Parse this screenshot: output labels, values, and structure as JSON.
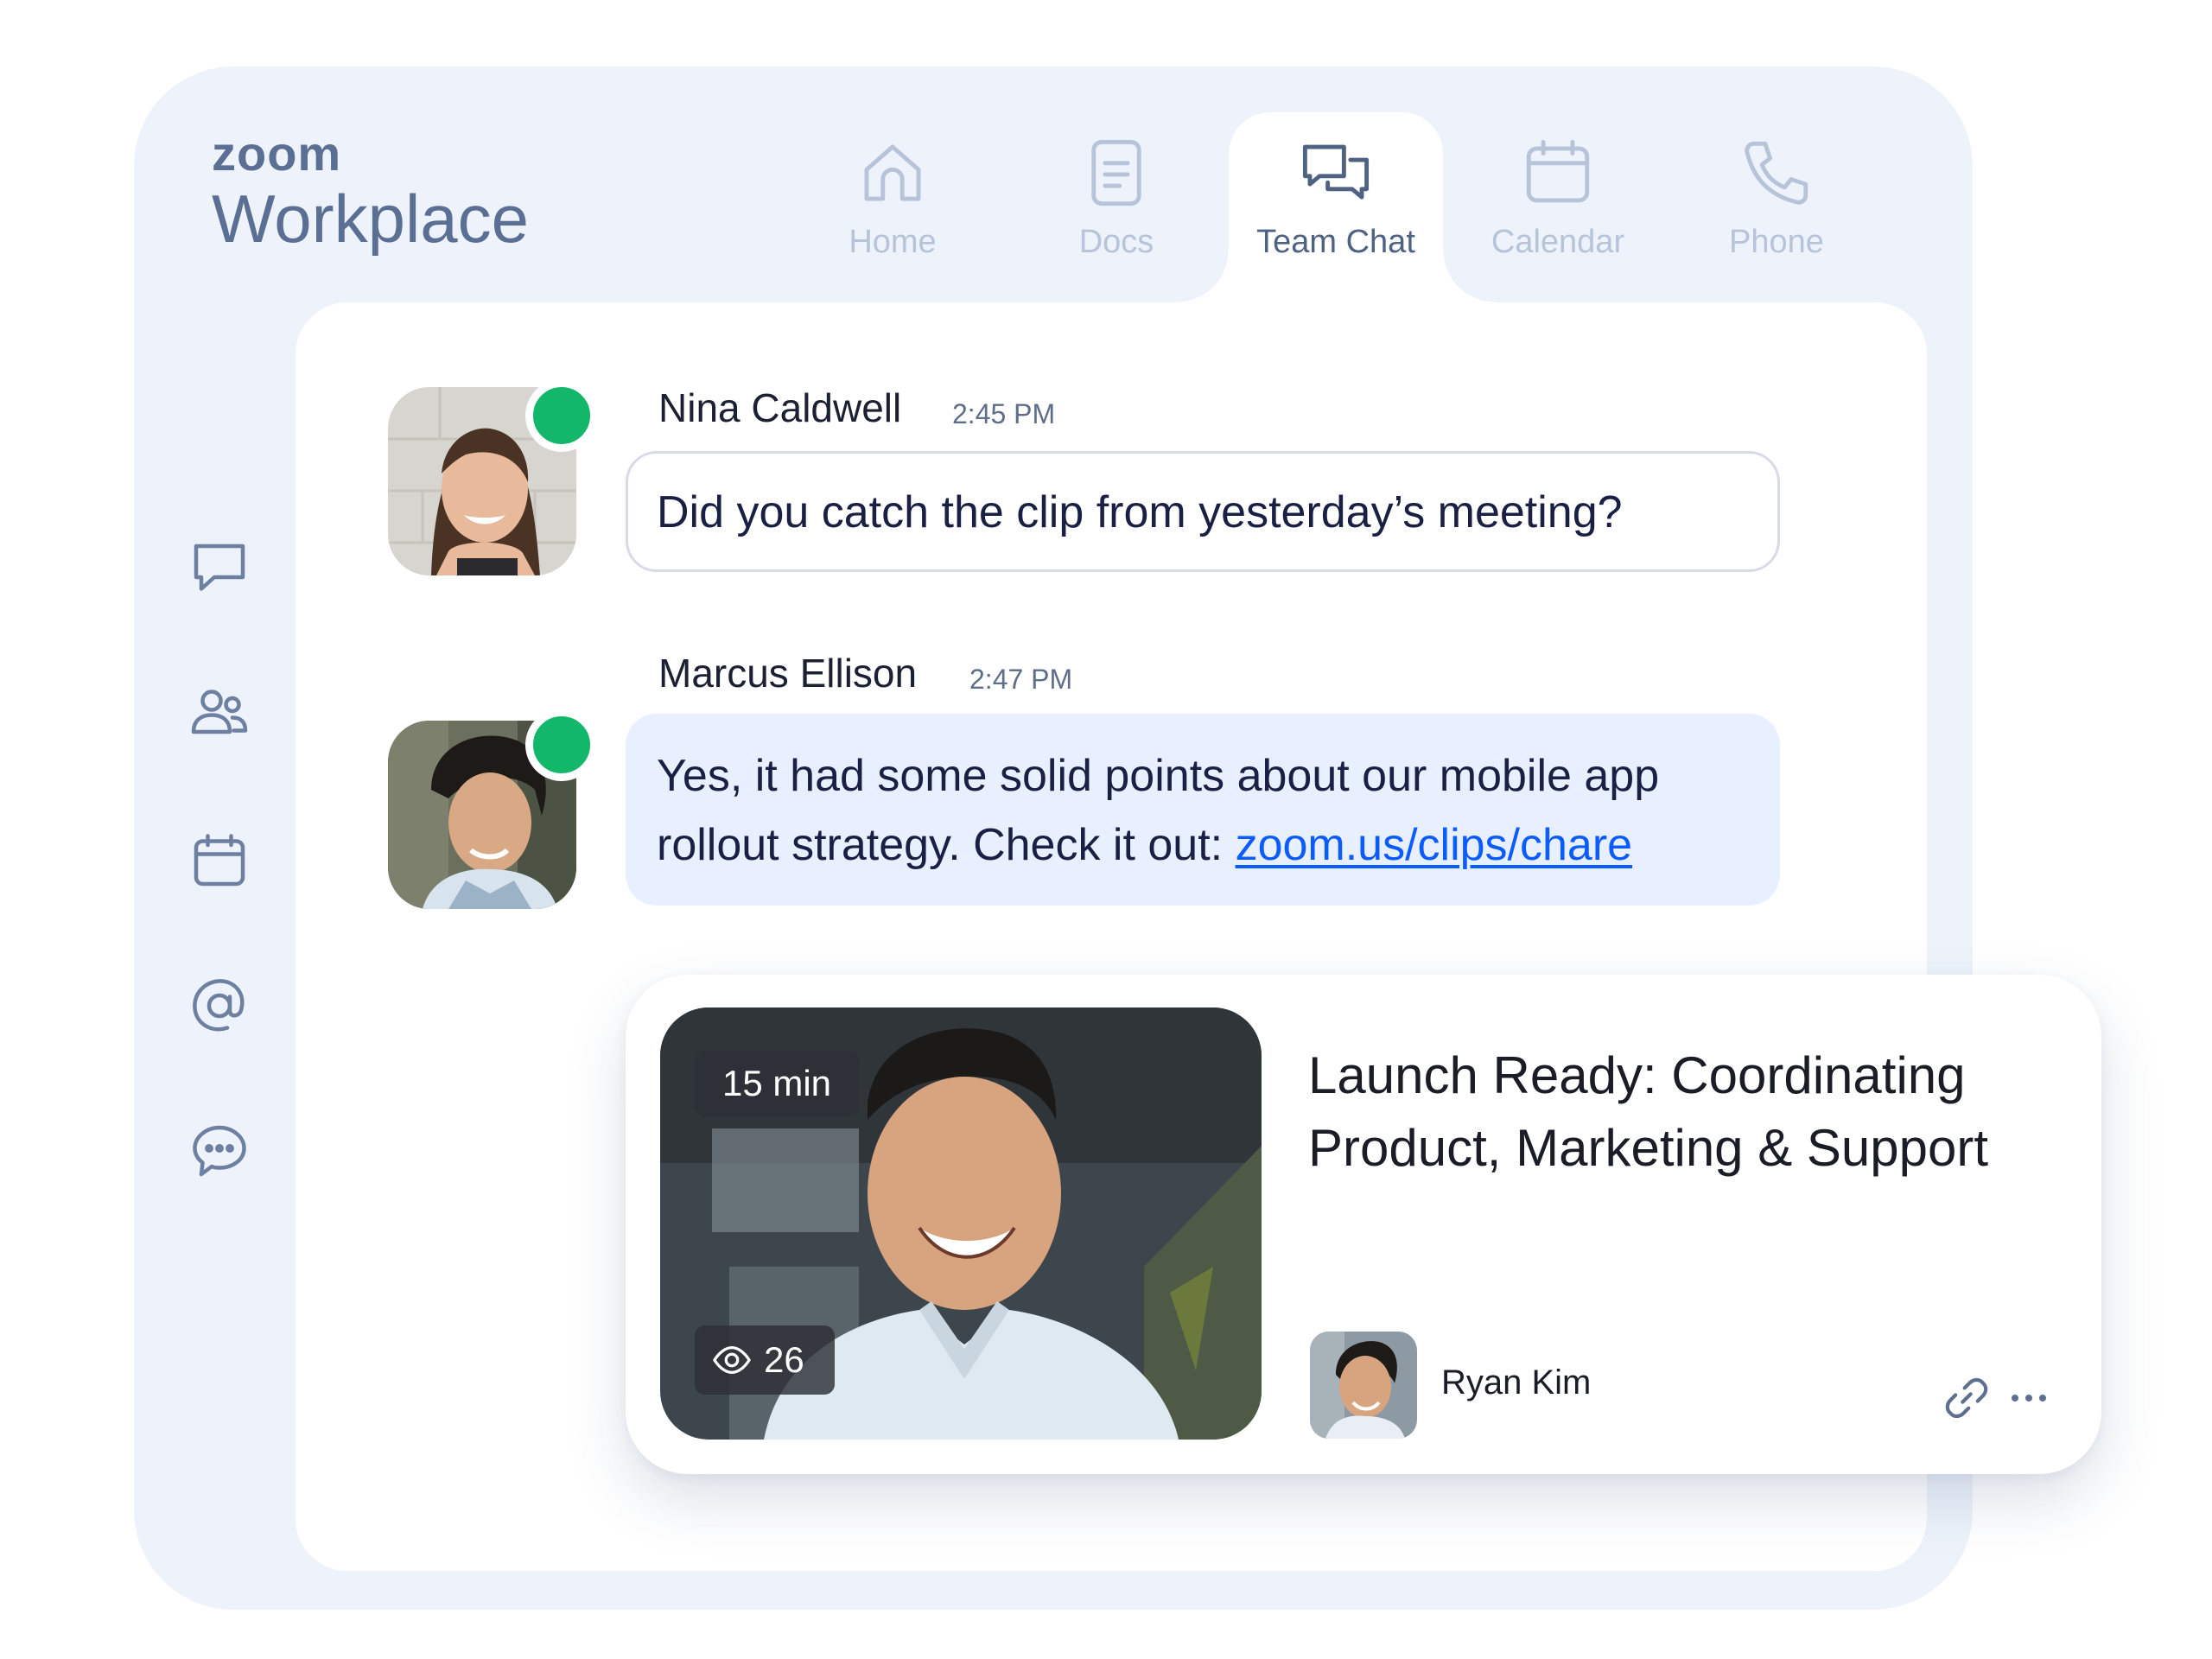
{
  "brand": {
    "logo_text": "zoom",
    "product": "Workplace"
  },
  "nav": {
    "tabs": [
      {
        "label": "Home",
        "icon": "home-icon",
        "active": false
      },
      {
        "label": "Docs",
        "icon": "document-icon",
        "active": false
      },
      {
        "label": "Team Chat",
        "icon": "chat-bubbles-icon",
        "active": true
      },
      {
        "label": "Calendar",
        "icon": "calendar-icon",
        "active": false
      },
      {
        "label": "Phone",
        "icon": "phone-icon",
        "active": false
      }
    ]
  },
  "sidebar": {
    "icons": [
      "chat-icon",
      "contacts-icon",
      "calendar-icon",
      "mentions-icon",
      "bot-chat-icon"
    ]
  },
  "messages": [
    {
      "sender": "Nina Caldwell",
      "time": "2:45 PM",
      "text": "Did you catch the clip from yesterday’s meeting?",
      "online": true
    },
    {
      "sender": "Marcus Ellison",
      "time": "2:47 PM",
      "text_line1": "Yes, it had some solid points about our mobile app",
      "text_line2": "rollout strategy. Check it out: ",
      "link": "zoom.us/clips/chare",
      "online": true
    }
  ],
  "clip": {
    "duration": "15 min",
    "views": "26",
    "title_line1": "Launch Ready: Coordinating",
    "title_line2": "Product, Marketing & Support",
    "author": "Ryan Kim",
    "actions": [
      "link-icon",
      "more-icon"
    ]
  },
  "colors": {
    "frame_bg": "#eef3fb",
    "panel_bg": "#ffffff",
    "presence": "#12b76a",
    "link": "#0b5cff",
    "inactive_nav": "#b6c3d8",
    "active_nav": "#4f6283",
    "filled_bubble": "#e8efff"
  }
}
